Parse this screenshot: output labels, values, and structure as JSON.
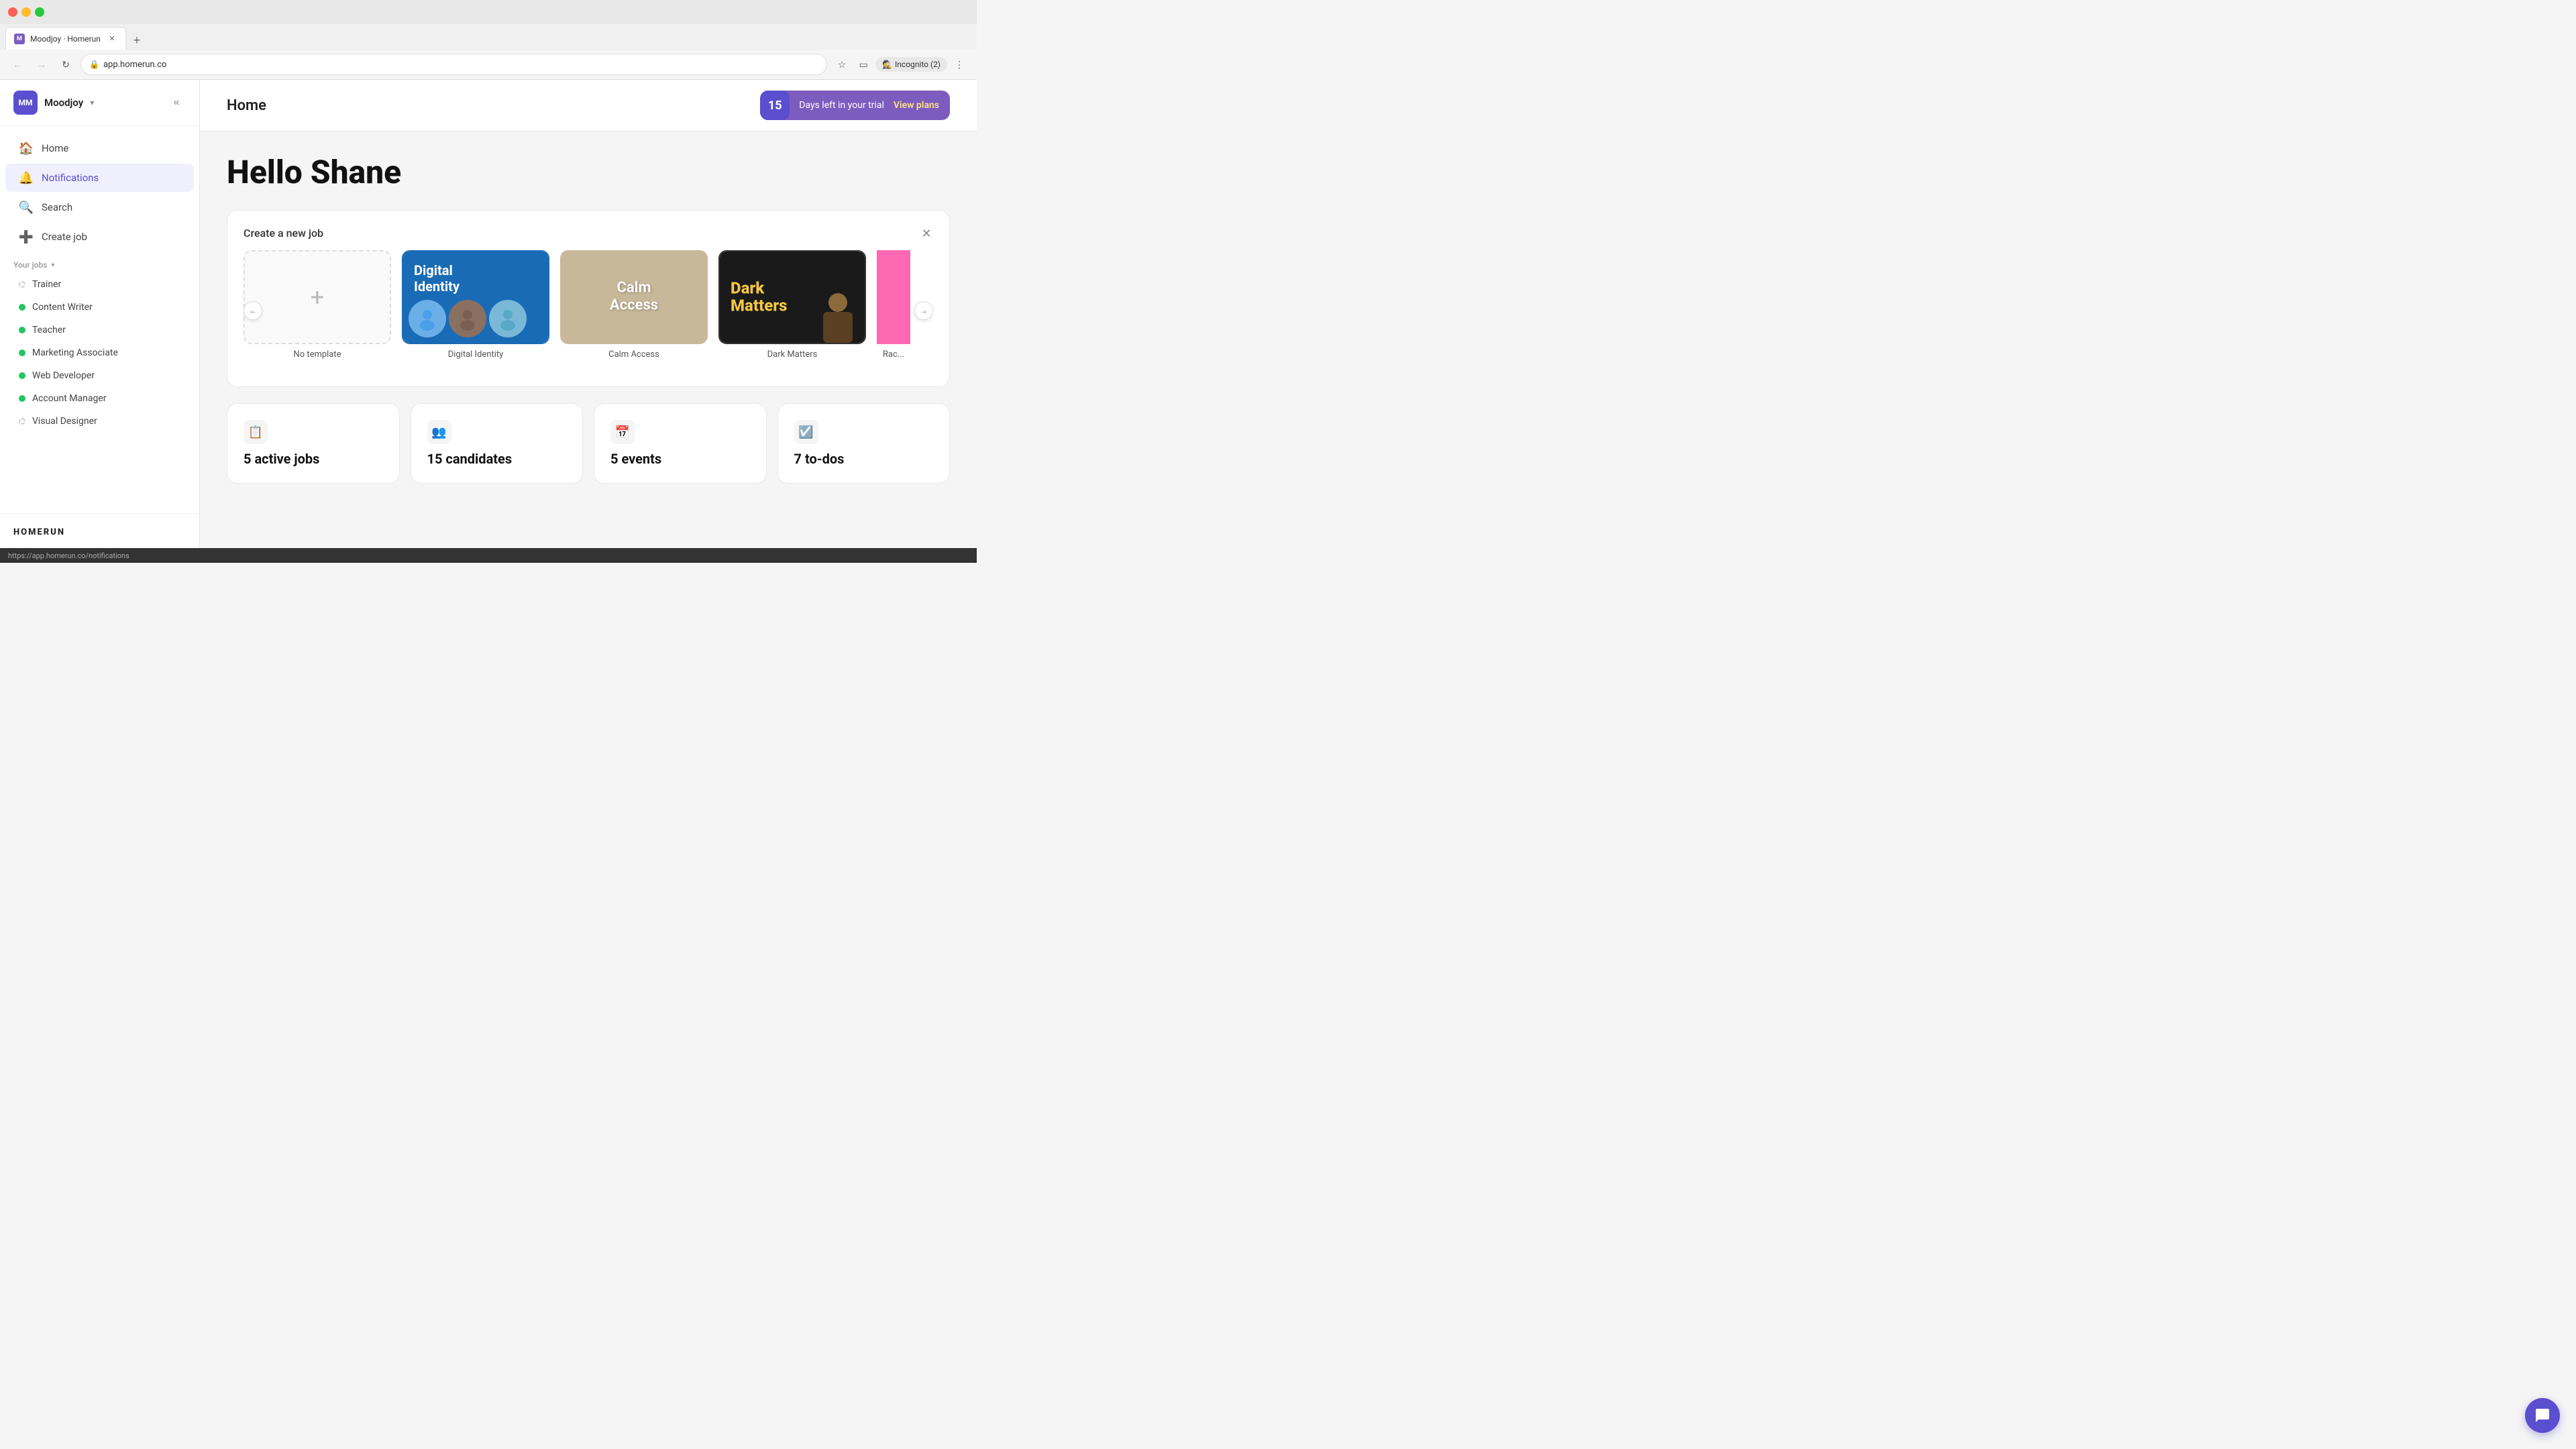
{
  "browser": {
    "tab_title": "Moodjoy · Homerun",
    "url": "app.homerun.co",
    "incognito_label": "Incognito (2)",
    "new_tab_label": "+"
  },
  "sidebar": {
    "brand_initials": "MM",
    "brand_name": "Moodjoy",
    "nav_items": [
      {
        "id": "home",
        "label": "Home",
        "icon": "🏠",
        "active": false
      },
      {
        "id": "notifications",
        "label": "Notifications",
        "icon": "🔔",
        "active": true
      },
      {
        "id": "search",
        "label": "Search",
        "icon": "🔍",
        "active": false
      },
      {
        "id": "create-job",
        "label": "Create job",
        "icon": "➕",
        "active": false
      }
    ],
    "jobs_section_label": "Your jobs",
    "jobs": [
      {
        "id": "trainer",
        "label": "Trainer",
        "dot": "outline"
      },
      {
        "id": "content-writer",
        "label": "Content Writer",
        "dot": "green"
      },
      {
        "id": "teacher",
        "label": "Teacher",
        "dot": "green"
      },
      {
        "id": "marketing-associate",
        "label": "Marketing Associate",
        "dot": "green"
      },
      {
        "id": "web-developer",
        "label": "Web Developer",
        "dot": "green"
      },
      {
        "id": "account-manager",
        "label": "Account Manager",
        "dot": "green"
      },
      {
        "id": "visual-designer",
        "label": "Visual Designer",
        "dot": "outline"
      }
    ],
    "footer_logo": "HOMERUN"
  },
  "header": {
    "page_title": "Home",
    "trial_days": "15",
    "trial_text": "Days left in your trial",
    "trial_link": "View plans"
  },
  "main": {
    "greeting": "Hello Shane",
    "create_job_title": "Create a new job",
    "templates": [
      {
        "id": "no-template",
        "label": "No template",
        "type": "blank"
      },
      {
        "id": "digital-identity",
        "label": "Digital Identity",
        "type": "digital-identity"
      },
      {
        "id": "calm-access",
        "label": "Calm Access",
        "type": "calm-access"
      },
      {
        "id": "dark-matters",
        "label": "Dark Matters",
        "type": "dark-matters"
      },
      {
        "id": "race",
        "label": "Rac...",
        "type": "race"
      }
    ],
    "stats": [
      {
        "id": "active-jobs",
        "icon": "📋",
        "value": "5 active jobs"
      },
      {
        "id": "candidates",
        "icon": "👥",
        "value": "15 candidates"
      },
      {
        "id": "events",
        "icon": "📅",
        "value": "5 events"
      },
      {
        "id": "todos",
        "icon": "☑️",
        "value": "7 to-dos"
      }
    ]
  },
  "status_bar": {
    "url": "https://app.homerun.co/notifications"
  }
}
